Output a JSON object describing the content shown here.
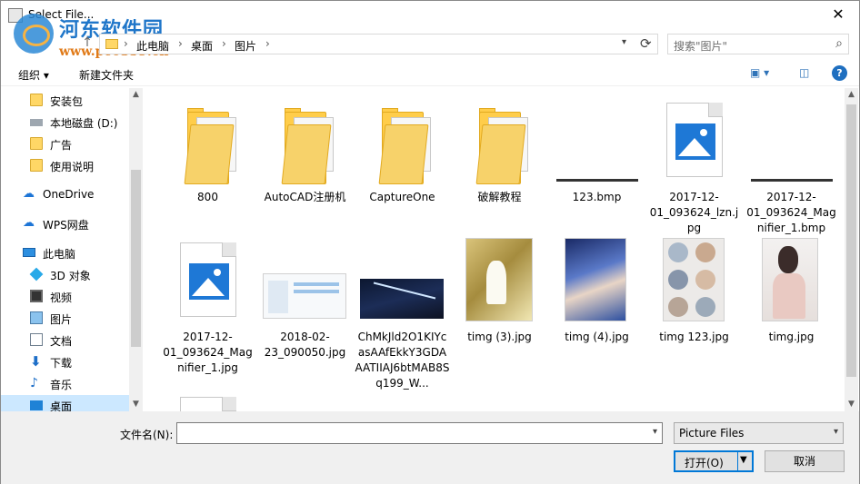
{
  "window": {
    "title": "Select File...",
    "close_glyph": "✕"
  },
  "watermark": {
    "line1": "河东软件园",
    "line2": "www.pc0359.cn"
  },
  "nav": {
    "up_glyph": "↑"
  },
  "address": {
    "crumbs": [
      "此电脑",
      "桌面",
      "图片"
    ],
    "sep": "›"
  },
  "search": {
    "placeholder": "搜索\"图片\""
  },
  "toolbar": {
    "organize": "组织 ▾",
    "new_folder": "新建文件夹"
  },
  "sidebar": {
    "items": [
      {
        "label": "安装包",
        "icon": "folder-icon"
      },
      {
        "label": "本地磁盘 (D:)",
        "icon": "drive-icon"
      },
      {
        "label": "广告",
        "icon": "folder-icon"
      },
      {
        "label": "使用说明",
        "icon": "folder-icon"
      },
      {
        "label": "OneDrive",
        "icon": "cloud-icon"
      },
      {
        "label": "WPS网盘",
        "icon": "cloud-icon"
      },
      {
        "label": "此电脑",
        "icon": "computer-icon"
      },
      {
        "label": "3D 对象",
        "icon": "cube-icon"
      },
      {
        "label": "视频",
        "icon": "video-icon"
      },
      {
        "label": "图片",
        "icon": "picture-icon"
      },
      {
        "label": "文档",
        "icon": "document-icon"
      },
      {
        "label": "下载",
        "icon": "download-icon"
      },
      {
        "label": "音乐",
        "icon": "music-icon"
      },
      {
        "label": "桌面",
        "icon": "desktop-icon"
      }
    ]
  },
  "files": [
    {
      "name": "800",
      "kind": "folder"
    },
    {
      "name": "AutoCAD注册机",
      "kind": "folder"
    },
    {
      "name": "CaptureOne",
      "kind": "folder"
    },
    {
      "name": "破解教程",
      "kind": "folder"
    },
    {
      "name": "123.bmp",
      "kind": "line"
    },
    {
      "name": "2017-12-01_093624_lzn.jpg",
      "kind": "imagefile"
    },
    {
      "name": "2017-12-01_093624_Magnifier_1.bmp",
      "kind": "line"
    },
    {
      "name": "2017-12-01_093624_Magnifier_1.jpg",
      "kind": "imagefile"
    },
    {
      "name": "2018-02-23_090050.jpg",
      "kind": "screenshot"
    },
    {
      "name": "ChMkJld2O1KIYcasAAfEkkY3GDAAATIIAJ6btMAB8Sq199_W...",
      "kind": "night"
    },
    {
      "name": "timg (3).jpg",
      "kind": "photo-yellow"
    },
    {
      "name": "timg (4).jpg",
      "kind": "photo-blue"
    },
    {
      "name": "timg 123.jpg",
      "kind": "photo-circles"
    },
    {
      "name": "timg.jpg",
      "kind": "photo-girl"
    }
  ],
  "footer": {
    "filename_label": "文件名(N):",
    "filename_value": "",
    "filter": "Picture Files",
    "open": "打开(O)",
    "cancel": "取消"
  },
  "colors": {
    "accent": "#0078d7",
    "selection": "#cce8ff",
    "folder": "#ffcd4a"
  }
}
